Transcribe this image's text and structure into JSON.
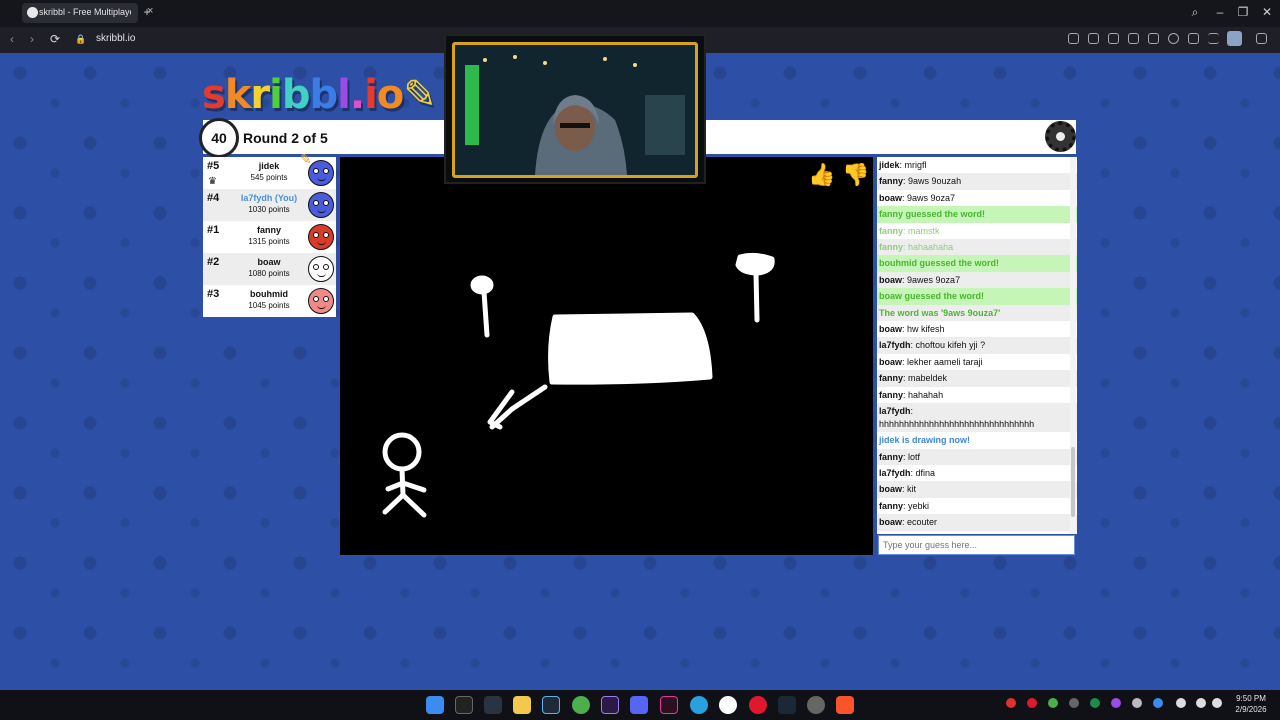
{
  "browser": {
    "tab_title": "skribbl - Free Multiplayer",
    "url": "skribbl.io",
    "tab_close": "×",
    "new_tab": "+",
    "back": "‹",
    "forward": "›",
    "reload": "⟳",
    "lock": "🔒",
    "search": "⌕",
    "minimize": "–",
    "maximize": "❐",
    "close": "✕"
  },
  "game": {
    "logo": "skribbl.io",
    "timer": "40",
    "round_label": "Round 2 of 5",
    "players": [
      {
        "rank": "#5",
        "name": "jidek",
        "points": "545 points",
        "color": "#4a5cdb",
        "drawing": true,
        "crown": true
      },
      {
        "rank": "#4",
        "name": "la7fydh (You)",
        "points": "1030 points",
        "color": "#4a5cdb",
        "you": true
      },
      {
        "rank": "#1",
        "name": "fanny",
        "points": "1315 points",
        "color": "#d93b2b"
      },
      {
        "rank": "#2",
        "name": "boaw",
        "points": "1080 points",
        "color": "#ffffff"
      },
      {
        "rank": "#3",
        "name": "bouhmid",
        "points": "1045 points",
        "color": "#f08a8a"
      }
    ],
    "chat": [
      {
        "user": "jidek",
        "text": "mrigfl"
      },
      {
        "user": "fanny",
        "text": "9aws 9ouzah"
      },
      {
        "user": "boaw",
        "text": "9aws 9oza7"
      },
      {
        "type": "green",
        "text": "fanny guessed the word!"
      },
      {
        "type": "dim",
        "user": "fanny",
        "text": "mamstk"
      },
      {
        "type": "dim",
        "user": "fanny",
        "text": "hahaahaha"
      },
      {
        "type": "green",
        "text": "bouhmid guessed the word!"
      },
      {
        "user": "boaw",
        "text": "9awes 9oza7"
      },
      {
        "type": "green",
        "text": "boaw guessed the word!"
      },
      {
        "type": "answer",
        "text": "The word was '9aws 9ouza7'"
      },
      {
        "user": "boaw",
        "text": "hw kifesh"
      },
      {
        "user": "la7fydh",
        "text": "choftou kifeh yji ?"
      },
      {
        "user": "boaw",
        "text": "lekher aameli taraji"
      },
      {
        "user": "fanny",
        "text": "mabeldek"
      },
      {
        "user": "fanny",
        "text": "hahahah"
      },
      {
        "type": "multi",
        "user": "la7fydh",
        "text": "hhhhhhhhhhhhhhhhhhhhhhhhhhhhhhh"
      },
      {
        "type": "blue",
        "text": "jidek is drawing now!"
      },
      {
        "user": "fanny",
        "text": "lotf"
      },
      {
        "user": "la7fydh",
        "text": "dfina"
      },
      {
        "user": "boaw",
        "text": "kit"
      },
      {
        "user": "fanny",
        "text": "yebki"
      },
      {
        "user": "boaw",
        "text": "ecouter"
      }
    ],
    "guess_placeholder": "Type your guess here...",
    "time": "9:50 PM",
    "date": "2/9/2026"
  },
  "icons": {
    "like": "thumbs-up-icon",
    "dislike": "thumbs-down-icon",
    "settings": "gear-icon",
    "clock": "alarm-clock-icon"
  }
}
